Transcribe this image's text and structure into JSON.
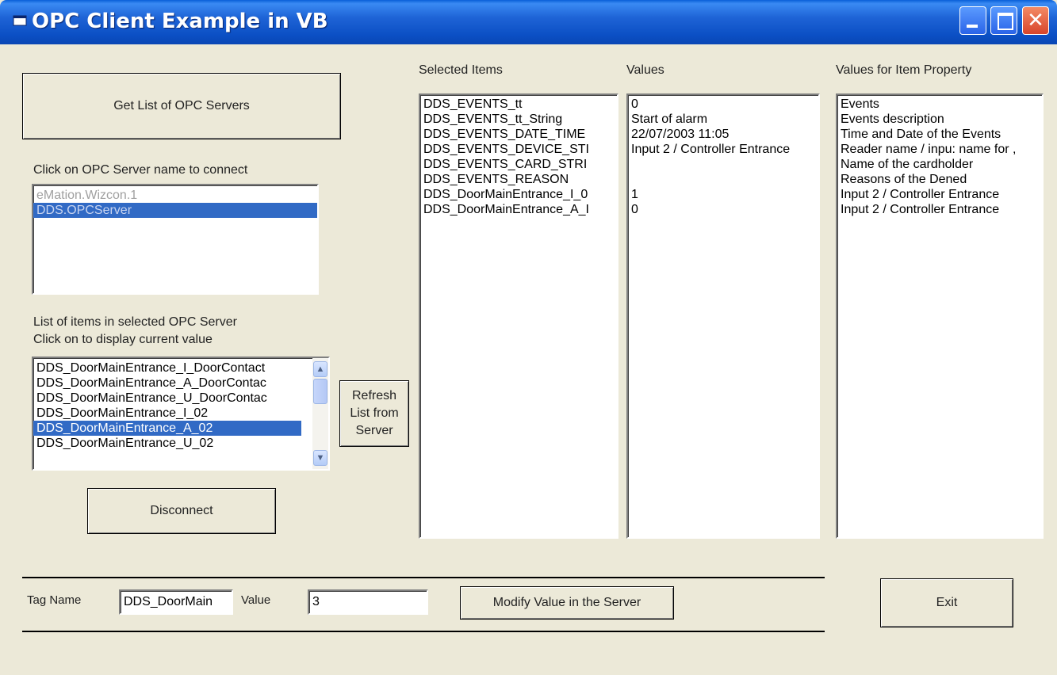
{
  "window": {
    "title": "OPC Client Example in VB",
    "icon": "app-icon",
    "controls": {
      "minimize": "_",
      "maximize": "□",
      "close": "✕"
    }
  },
  "left": {
    "get_servers_button": "Get List of OPC Servers",
    "connect_label": "Click on OPC Server name to connect",
    "servers": [
      {
        "name": "eMation.Wizcon.1"
      },
      {
        "name": "DDS.OPCServer"
      }
    ],
    "items_label_line1": "List of items in selected  OPC Server",
    "items_label_line2": "Click on to display current value",
    "items": [
      "DDS_DoorMainEntrance_I_DoorContact",
      "DDS_DoorMainEntrance_A_DoorContac",
      "DDS_DoorMainEntrance_U_DoorContac",
      "DDS_DoorMainEntrance_I_02",
      "DDS_DoorMainEntrance_A_02",
      "DDS_DoorMainEntrance_U_02"
    ],
    "disconnect_button": "Disconnect"
  },
  "refresh_button": {
    "line1": "Refresh",
    "line2": "List from",
    "line3": "Server"
  },
  "columns": {
    "selected_items_header": "Selected Items",
    "values_header": "Values",
    "properties_header": "Values for Item Property",
    "selected_items": [
      "DDS_EVENTS_tt",
      "DDS_EVENTS_tt_String",
      "DDS_EVENTS_DATE_TIME",
      "DDS_EVENTS_DEVICE_STI",
      "DDS_EVENTS_CARD_STRI",
      "DDS_EVENTS_REASON",
      "DDS_DoorMainEntrance_I_0",
      "DDS_DoorMainEntrance_A_I"
    ],
    "values": [
      "0",
      "Start of alarm",
      "22/07/2003 11:05",
      "Input 2 / Controller Entrance",
      "",
      "",
      "1",
      "0"
    ],
    "properties": [
      "Events",
      "Events description",
      "Time and Date of the Events",
      "Reader name / inpu: name for ,",
      "Name of the cardholder",
      "Reasons of the Dened",
      "Input 2 / Controller Entrance",
      "Input 2 / Controller Entrance"
    ]
  },
  "bottom": {
    "tag_name_label": "Tag Name",
    "tag_name_value": "DDS_DoorMain",
    "value_label": "Value",
    "value_value": "3",
    "modify_button": "Modify Value in the Server",
    "exit_button": "Exit"
  }
}
